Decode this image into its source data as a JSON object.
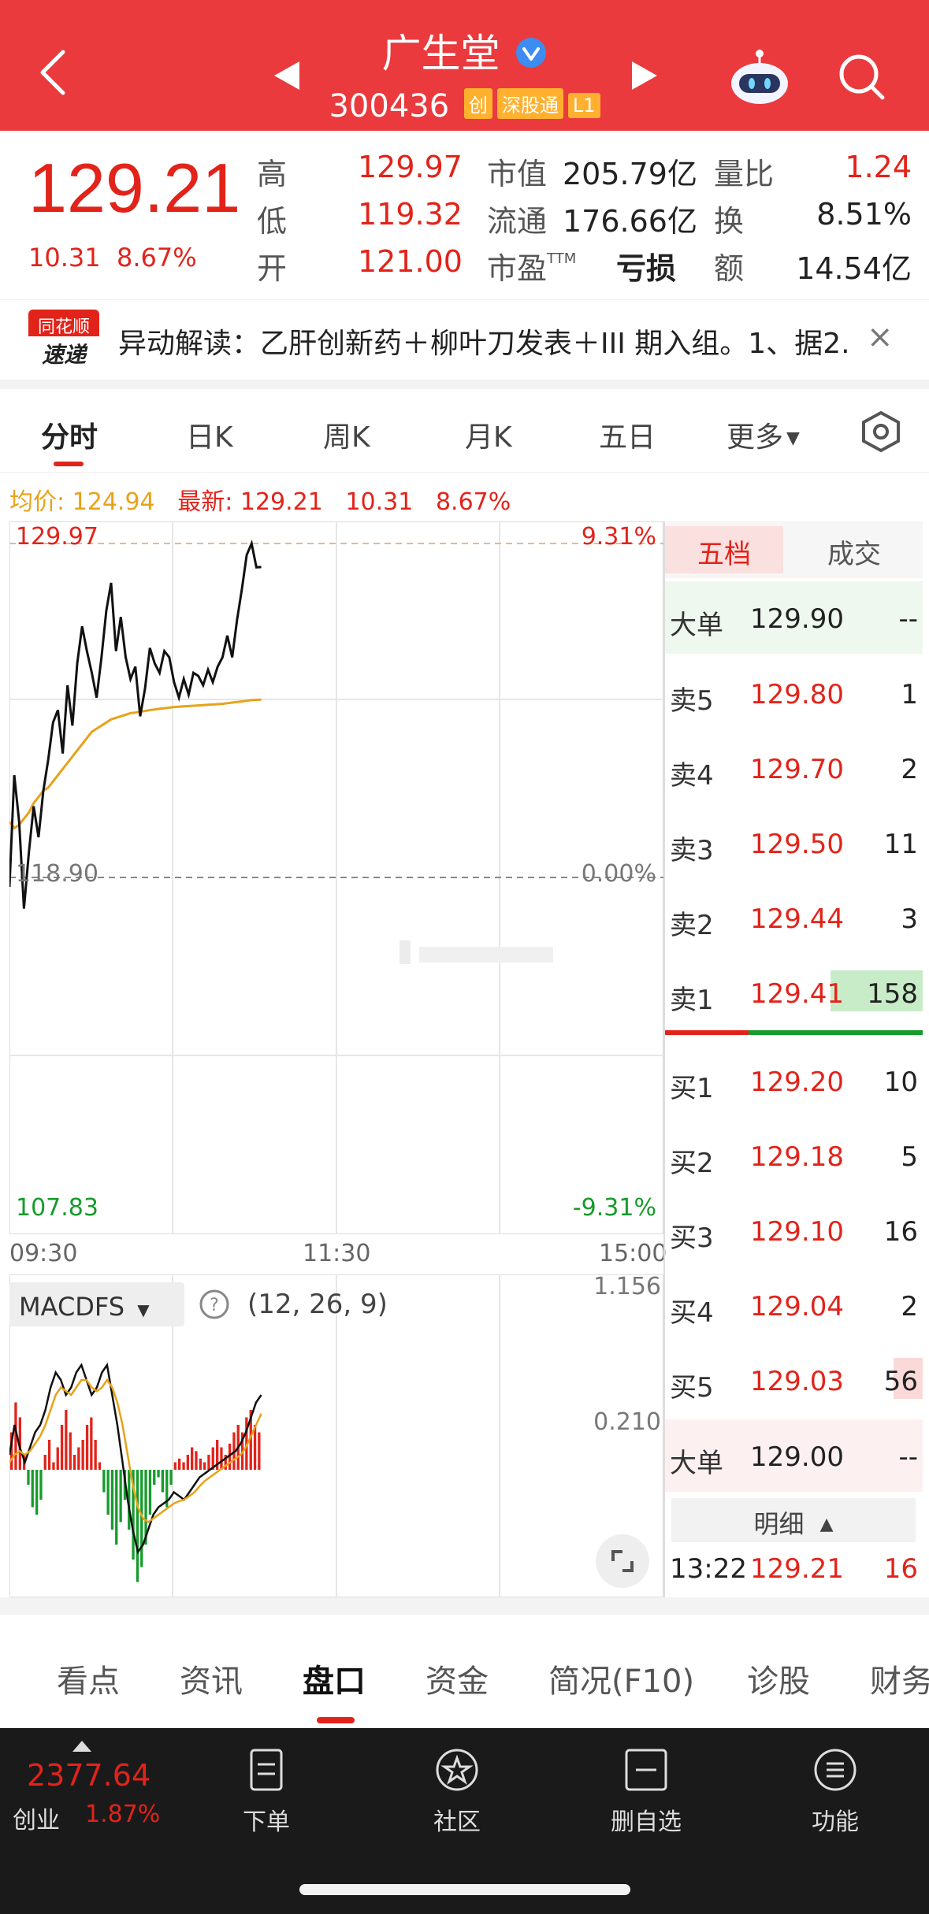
{
  "header": {
    "title": "广生堂",
    "code": "300436",
    "tags": [
      "创",
      "深股通",
      "L1"
    ]
  },
  "quote": {
    "price": "129.21",
    "change": "10.31",
    "change_pct": "8.67%",
    "rows": [
      {
        "l1": "高",
        "v1": "129.97",
        "l2": "市值",
        "v2": "205.79亿",
        "l3": "量比",
        "v3": "1.24"
      },
      {
        "l1": "低",
        "v1": "119.32",
        "l2": "流通",
        "v2": "176.66亿",
        "l3": "换",
        "v3": "8.51%"
      },
      {
        "l1": "开",
        "v1": "121.00",
        "l2": "市盈",
        "l2_sup": "TTM",
        "v2": "亏损",
        "l3": "额",
        "v3": "14.54亿"
      }
    ]
  },
  "news": {
    "logo_top": "同花顺",
    "logo_bottom": "速递",
    "text": "异动解读：乙肝创新药＋柳叶刀发表＋III 期入组。1、据2...",
    "close": "×"
  },
  "ktabs": [
    "分时",
    "日K",
    "周K",
    "月K",
    "五日",
    "更多"
  ],
  "info": {
    "avg_label": "均价: 124.94",
    "latest_label": "最新: 129.21",
    "chg": "10.31",
    "pct": "8.67%"
  },
  "chart_data": {
    "type": "line",
    "x_range": [
      "09:30",
      "15:00"
    ],
    "x_ticks": [
      "09:30",
      "11:30",
      "15:00"
    ],
    "ylim": [
      107.83,
      129.97
    ],
    "y_labels": {
      "top": "129.97",
      "mid": "118.90",
      "bottom": "107.83"
    },
    "pct_labels": {
      "top": "9.31%",
      "mid": "0.00%",
      "bottom": "-9.31%"
    },
    "series": [
      {
        "name": "最新",
        "values": [
          118.9,
          122.5,
          121.0,
          118.2,
          120.0,
          121.5,
          120.5,
          122.0,
          123.0,
          124.2,
          124.6,
          123.2,
          125.4,
          124.1,
          126.1,
          127.3,
          126.5,
          125.8,
          125.0,
          126.3,
          127.8,
          128.7,
          126.5,
          127.6,
          126.3,
          125.6,
          126.0,
          124.4,
          125.3,
          126.6,
          126.1,
          125.8,
          126.5,
          126.3,
          125.5,
          125.0,
          125.6,
          125.1,
          125.8,
          125.7,
          125.4,
          125.9,
          125.5,
          126.0,
          126.3,
          127.0,
          126.3,
          127.5,
          128.5,
          129.6,
          129.97,
          129.2,
          129.21
        ]
      },
      {
        "name": "均价",
        "values": [
          121.0,
          120.8,
          120.9,
          121.1,
          121.3,
          121.6,
          121.8,
          122.0,
          122.1,
          122.3,
          122.5,
          122.7,
          122.9,
          123.1,
          123.3,
          123.5,
          123.7,
          123.9,
          124.0,
          124.1,
          124.2,
          124.3,
          124.35,
          124.4,
          124.45,
          124.5,
          124.52,
          124.55,
          124.57,
          124.6,
          124.62,
          124.64,
          124.66,
          124.68,
          124.7,
          124.71,
          124.72,
          124.73,
          124.74,
          124.75,
          124.76,
          124.77,
          124.78,
          124.79,
          124.8,
          124.82,
          124.84,
          124.86,
          124.88,
          124.9,
          124.92,
          124.93,
          124.94
        ]
      }
    ],
    "macd": {
      "label": "MACDFS",
      "params": "(12, 26, 9)",
      "ylabels": [
        "1.156",
        "0.210"
      ],
      "hist": [
        0.5,
        0.9,
        0.7,
        0.2,
        -0.2,
        -0.5,
        -0.6,
        -0.4,
        0.2,
        0.4,
        0.1,
        0.3,
        0.6,
        0.8,
        0.5,
        0.2,
        0.3,
        0.4,
        0.6,
        0.7,
        0.4,
        0.1,
        -0.3,
        -0.6,
        -0.8,
        -1.0,
        -0.7,
        -0.4,
        -0.8,
        -1.2,
        -1.5,
        -1.3,
        -1.0,
        -0.6,
        -0.2,
        -0.1,
        -0.3,
        -0.5,
        -0.2,
        0.1,
        0.15,
        0.1,
        0.2,
        0.3,
        0.25,
        0.15,
        0.1,
        0.2,
        0.3,
        0.4,
        0.3,
        0.2,
        0.35,
        0.5,
        0.6,
        0.5,
        0.7,
        0.8,
        0.6,
        0.5
      ],
      "dif": [
        0.2,
        0.6,
        0.3,
        0.1,
        0.3,
        0.5,
        0.6,
        0.8,
        1.1,
        1.3,
        1.2,
        1.0,
        1.1,
        1.3,
        1.4,
        1.2,
        1.0,
        1.1,
        1.3,
        1.4,
        1.0,
        0.6,
        0.1,
        -0.4,
        -0.8,
        -1.1,
        -1.0,
        -0.8,
        -0.6,
        -0.5,
        -0.45,
        -0.4,
        -0.3,
        -0.35,
        -0.4,
        -0.3,
        -0.2,
        -0.1,
        -0.05,
        0.0,
        0.05,
        0.1,
        0.15,
        0.2,
        0.25,
        0.35,
        0.5,
        0.7,
        0.9,
        1.0
      ],
      "dea": [
        0.1,
        0.2,
        0.25,
        0.2,
        0.25,
        0.35,
        0.45,
        0.6,
        0.8,
        1.0,
        1.1,
        1.05,
        1.0,
        1.1,
        1.2,
        1.2,
        1.1,
        1.05,
        1.1,
        1.2,
        1.1,
        0.9,
        0.6,
        0.2,
        -0.2,
        -0.5,
        -0.65,
        -0.7,
        -0.65,
        -0.6,
        -0.55,
        -0.5,
        -0.45,
        -0.42,
        -0.4,
        -0.35,
        -0.3,
        -0.22,
        -0.15,
        -0.1,
        -0.05,
        0.0,
        0.05,
        0.1,
        0.15,
        0.2,
        0.3,
        0.45,
        0.6,
        0.75
      ]
    }
  },
  "orderbook": {
    "tabs": [
      "五档",
      "成交"
    ],
    "big_sell": {
      "label": "大单",
      "price": "129.90",
      "vol": "--"
    },
    "asks": [
      {
        "label": "卖5",
        "price": "129.80",
        "vol": "1"
      },
      {
        "label": "卖4",
        "price": "129.70",
        "vol": "2"
      },
      {
        "label": "卖3",
        "price": "129.50",
        "vol": "11"
      },
      {
        "label": "卖2",
        "price": "129.44",
        "vol": "3"
      },
      {
        "label": "卖1",
        "price": "129.41",
        "vol": "158"
      }
    ],
    "bids": [
      {
        "label": "买1",
        "price": "129.20",
        "vol": "10"
      },
      {
        "label": "买2",
        "price": "129.18",
        "vol": "5"
      },
      {
        "label": "买3",
        "price": "129.10",
        "vol": "16"
      },
      {
        "label": "买4",
        "price": "129.04",
        "vol": "2"
      },
      {
        "label": "买5",
        "price": "129.03",
        "vol": "56"
      }
    ],
    "big_buy": {
      "label": "大单",
      "price": "129.00",
      "vol": "--"
    },
    "detail_label": "明细",
    "tick": {
      "time": "13:22",
      "price": "129.21",
      "vol": "16"
    }
  },
  "bottom_tabs": [
    "看点",
    "资讯",
    "盘口",
    "资金",
    "简况(F10)",
    "诊股",
    "财务"
  ],
  "footer": {
    "index_value": "2377.64",
    "index_name": "创业",
    "index_pct": "1.87%",
    "items": [
      "下单",
      "社区",
      "删自选",
      "功能"
    ]
  },
  "colors": {
    "header_red": "#ea3a3d",
    "up_red": "#e2231a",
    "down_green": "#169b2b",
    "avg_gold": "#e8a21a"
  }
}
